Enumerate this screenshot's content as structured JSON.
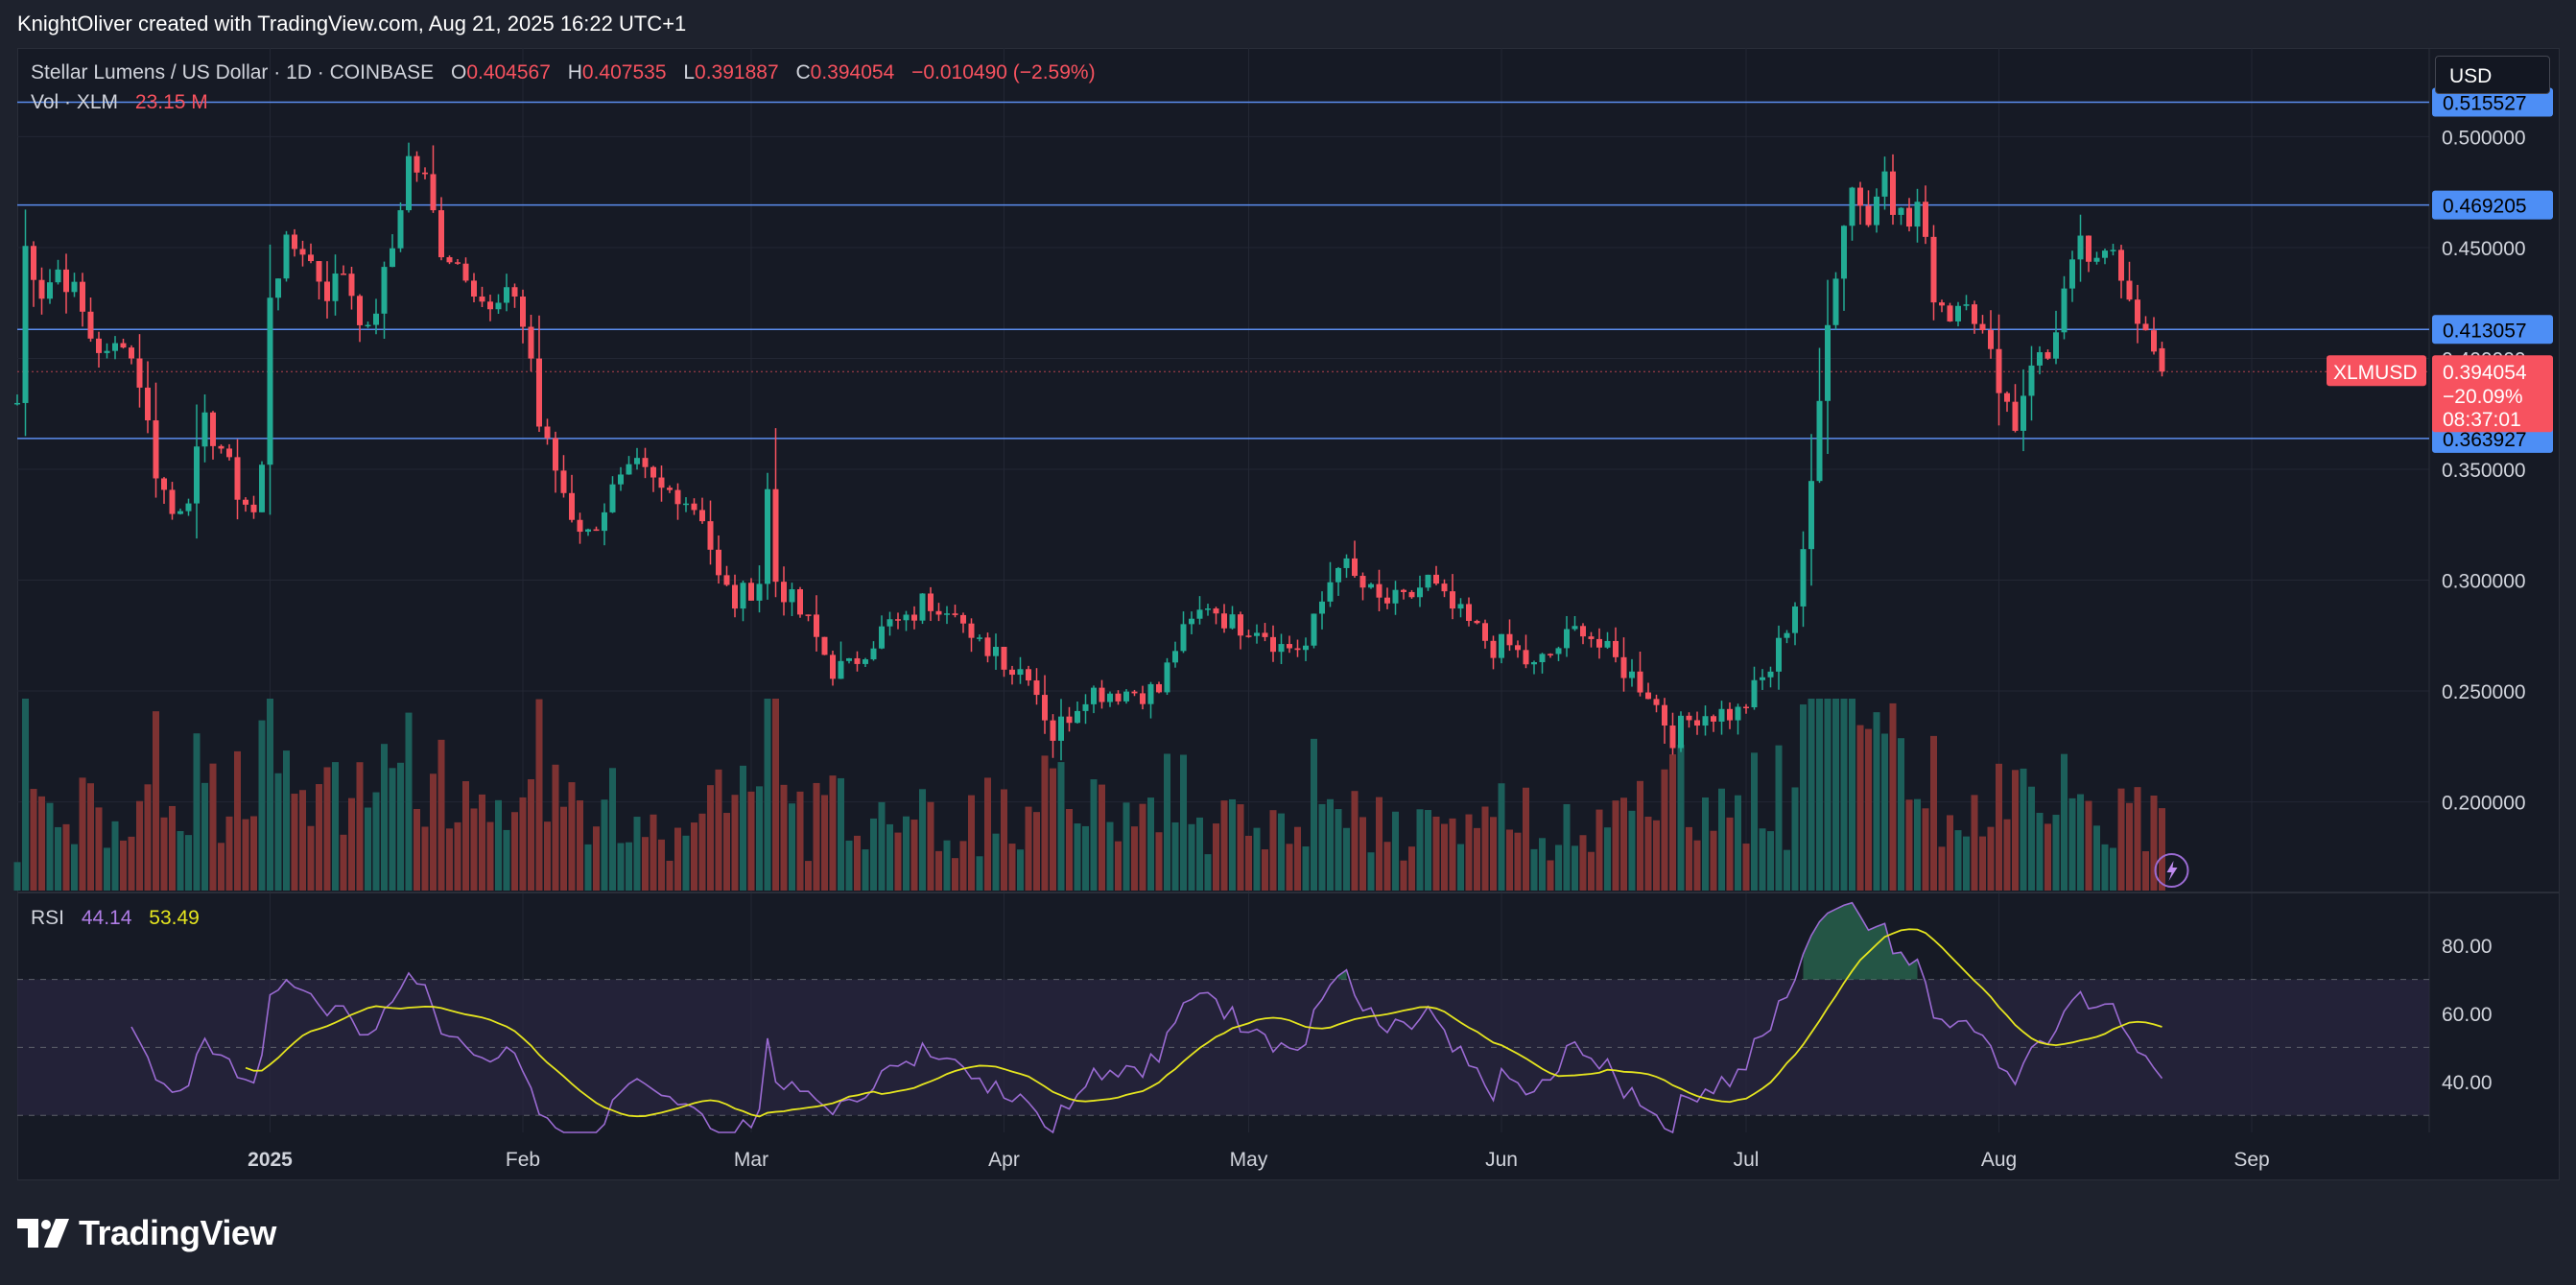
{
  "header": {
    "creator_text": "KnightOliver created with TradingView.com, Aug 21, 2025 16:22 UTC+1"
  },
  "legend": {
    "symbol": "Stellar Lumens / US Dollar · 1D · COINBASE",
    "o_label": "O",
    "o_value": "0.404567",
    "h_label": "H",
    "h_value": "0.407535",
    "l_label": "L",
    "l_value": "0.391887",
    "c_label": "C",
    "c_value": "0.394054",
    "change": "−0.010490 (−2.59%)",
    "vol_label": "Vol · XLM",
    "vol_value": "23.15 M",
    "rsi_label": "RSI",
    "rsi_value": "44.14",
    "rsi_ma_value": "53.49"
  },
  "toolbar": {
    "currency": "USD"
  },
  "price_axis": {
    "ticks": [
      "0.500000",
      "0.450000",
      "0.400000",
      "0.350000",
      "0.300000",
      "0.250000",
      "0.200000"
    ],
    "tick_values": [
      0.5,
      0.45,
      0.4,
      0.35,
      0.3,
      0.25,
      0.2
    ]
  },
  "hlines": [
    {
      "label": "0.515527",
      "value": 0.515527
    },
    {
      "label": "0.469205",
      "value": 0.469205
    },
    {
      "label": "0.413057",
      "value": 0.413057
    },
    {
      "label": "0.363927",
      "value": 0.363927
    }
  ],
  "last_price": {
    "symbol": "XLMUSD",
    "price": "0.394054",
    "change_pct": "−20.09%",
    "countdown": "08:37:01",
    "value": 0.394054
  },
  "rsi_axis": {
    "ticks": [
      "80.00",
      "60.00",
      "40.00"
    ],
    "tick_values": [
      80,
      60,
      40
    ],
    "band_upper": 70,
    "band_mid": 50,
    "band_lower": 30
  },
  "time_axis": {
    "labels": [
      "2025",
      "Feb",
      "Mar",
      "Apr",
      "May",
      "Jun",
      "Jul",
      "Aug",
      "Sep"
    ],
    "dates": [
      "2025-01-01",
      "2025-02-01",
      "2025-03-01",
      "2025-04-01",
      "2025-05-01",
      "2025-06-01",
      "2025-07-01",
      "2025-08-01",
      "2025-09-01"
    ]
  },
  "colors": {
    "up": "#22ab94",
    "down": "#f7525f",
    "vol_up": "#1c5f5a",
    "vol_down": "#7d3232",
    "hline": "#5b8def",
    "hline_label_bg": "#4d8ef5",
    "rsi_line": "#9b6bd3",
    "rsi_ma": "#e5e51f",
    "rsi_band_fill": "#2a2640"
  },
  "footer": {
    "brand": "TradingView"
  },
  "chart_data": {
    "type": "candlestick",
    "symbol": "XLMUSD",
    "interval": "1D",
    "x_start": "2024-12-01",
    "close_anchors": [
      [
        "2024-12-01",
        0.38
      ],
      [
        "2024-12-02",
        0.45
      ],
      [
        "2024-12-04",
        0.43
      ],
      [
        "2024-12-06",
        0.44
      ],
      [
        "2024-12-08",
        0.43
      ],
      [
        "2024-12-10",
        0.41
      ],
      [
        "2024-12-12",
        0.4
      ],
      [
        "2024-12-14",
        0.41
      ],
      [
        "2024-12-16",
        0.39
      ],
      [
        "2024-12-18",
        0.35
      ],
      [
        "2024-12-20",
        0.33
      ],
      [
        "2024-12-22",
        0.34
      ],
      [
        "2024-12-24",
        0.37
      ],
      [
        "2024-12-26",
        0.36
      ],
      [
        "2024-12-28",
        0.34
      ],
      [
        "2024-12-30",
        0.33
      ],
      [
        "2024-12-31",
        0.35
      ],
      [
        "2025-01-01",
        0.43
      ],
      [
        "2025-01-03",
        0.45
      ],
      [
        "2025-01-05",
        0.45
      ],
      [
        "2025-01-08",
        0.43
      ],
      [
        "2025-01-10",
        0.44
      ],
      [
        "2025-01-13",
        0.41
      ],
      [
        "2025-01-16",
        0.45
      ],
      [
        "2025-01-18",
        0.49
      ],
      [
        "2025-01-20",
        0.48
      ],
      [
        "2025-01-22",
        0.45
      ],
      [
        "2025-01-25",
        0.44
      ],
      [
        "2025-01-28",
        0.42
      ],
      [
        "2025-01-31",
        0.43
      ],
      [
        "2025-02-02",
        0.4
      ],
      [
        "2025-02-03",
        0.37
      ],
      [
        "2025-02-05",
        0.35
      ],
      [
        "2025-02-07",
        0.33
      ],
      [
        "2025-02-09",
        0.32
      ],
      [
        "2025-02-12",
        0.34
      ],
      [
        "2025-02-15",
        0.35
      ],
      [
        "2025-02-18",
        0.34
      ],
      [
        "2025-02-20",
        0.34
      ],
      [
        "2025-02-23",
        0.33
      ],
      [
        "2025-02-25",
        0.3
      ],
      [
        "2025-02-27",
        0.29
      ],
      [
        "2025-03-02",
        0.3
      ],
      [
        "2025-03-03",
        0.34
      ],
      [
        "2025-03-04",
        0.3
      ],
      [
        "2025-03-06",
        0.29
      ],
      [
        "2025-03-08",
        0.28
      ],
      [
        "2025-03-11",
        0.26
      ],
      [
        "2025-03-13",
        0.26
      ],
      [
        "2025-03-15",
        0.27
      ],
      [
        "2025-03-18",
        0.28
      ],
      [
        "2025-03-20",
        0.28
      ],
      [
        "2025-03-22",
        0.29
      ],
      [
        "2025-03-24",
        0.29
      ],
      [
        "2025-03-26",
        0.29
      ],
      [
        "2025-03-28",
        0.27
      ],
      [
        "2025-03-31",
        0.27
      ],
      [
        "2025-04-02",
        0.26
      ],
      [
        "2025-04-04",
        0.26
      ],
      [
        "2025-04-07",
        0.23
      ],
      [
        "2025-04-09",
        0.24
      ],
      [
        "2025-04-11",
        0.25
      ],
      [
        "2025-04-14",
        0.25
      ],
      [
        "2025-04-17",
        0.25
      ],
      [
        "2025-04-20",
        0.25
      ],
      [
        "2025-04-22",
        0.27
      ],
      [
        "2025-04-24",
        0.28
      ],
      [
        "2025-04-26",
        0.29
      ],
      [
        "2025-04-29",
        0.28
      ],
      [
        "2025-05-02",
        0.28
      ],
      [
        "2025-05-05",
        0.27
      ],
      [
        "2025-05-08",
        0.27
      ],
      [
        "2025-05-10",
        0.29
      ],
      [
        "2025-05-12",
        0.31
      ],
      [
        "2025-05-14",
        0.3
      ],
      [
        "2025-05-17",
        0.29
      ],
      [
        "2025-05-20",
        0.29
      ],
      [
        "2025-05-23",
        0.3
      ],
      [
        "2025-05-25",
        0.29
      ],
      [
        "2025-05-28",
        0.28
      ],
      [
        "2025-05-31",
        0.27
      ],
      [
        "2025-06-02",
        0.27
      ],
      [
        "2025-06-05",
        0.26
      ],
      [
        "2025-06-08",
        0.27
      ],
      [
        "2025-06-11",
        0.28
      ],
      [
        "2025-06-13",
        0.27
      ],
      [
        "2025-06-16",
        0.26
      ],
      [
        "2025-06-19",
        0.25
      ],
      [
        "2025-06-22",
        0.23
      ],
      [
        "2025-06-25",
        0.24
      ],
      [
        "2025-06-28",
        0.24
      ],
      [
        "2025-06-30",
        0.24
      ],
      [
        "2025-07-02",
        0.25
      ],
      [
        "2025-07-04",
        0.26
      ],
      [
        "2025-07-07",
        0.29
      ],
      [
        "2025-07-09",
        0.34
      ],
      [
        "2025-07-11",
        0.42
      ],
      [
        "2025-07-13",
        0.46
      ],
      [
        "2025-07-14",
        0.48
      ],
      [
        "2025-07-16",
        0.46
      ],
      [
        "2025-07-18",
        0.49
      ],
      [
        "2025-07-19",
        0.47
      ],
      [
        "2025-07-21",
        0.46
      ],
      [
        "2025-07-22",
        0.47
      ],
      [
        "2025-07-24",
        0.43
      ],
      [
        "2025-07-26",
        0.42
      ],
      [
        "2025-07-28",
        0.43
      ],
      [
        "2025-07-30",
        0.41
      ],
      [
        "2025-08-01",
        0.39
      ],
      [
        "2025-08-03",
        0.37
      ],
      [
        "2025-08-05",
        0.4
      ],
      [
        "2025-08-07",
        0.4
      ],
      [
        "2025-08-09",
        0.43
      ],
      [
        "2025-08-11",
        0.45
      ],
      [
        "2025-08-13",
        0.44
      ],
      [
        "2025-08-15",
        0.45
      ],
      [
        "2025-08-17",
        0.43
      ],
      [
        "2025-08-19",
        0.41
      ],
      [
        "2025-08-21",
        0.394054
      ]
    ],
    "ylim": [
      0.16,
      0.54
    ],
    "rsi_ylim": [
      25,
      95
    ],
    "last": {
      "open": 0.404567,
      "high": 0.407535,
      "low": 0.391887,
      "close": 0.394054,
      "volume": "23.15 M"
    },
    "rsi": 44.14,
    "rsi_ma": 53.49
  }
}
